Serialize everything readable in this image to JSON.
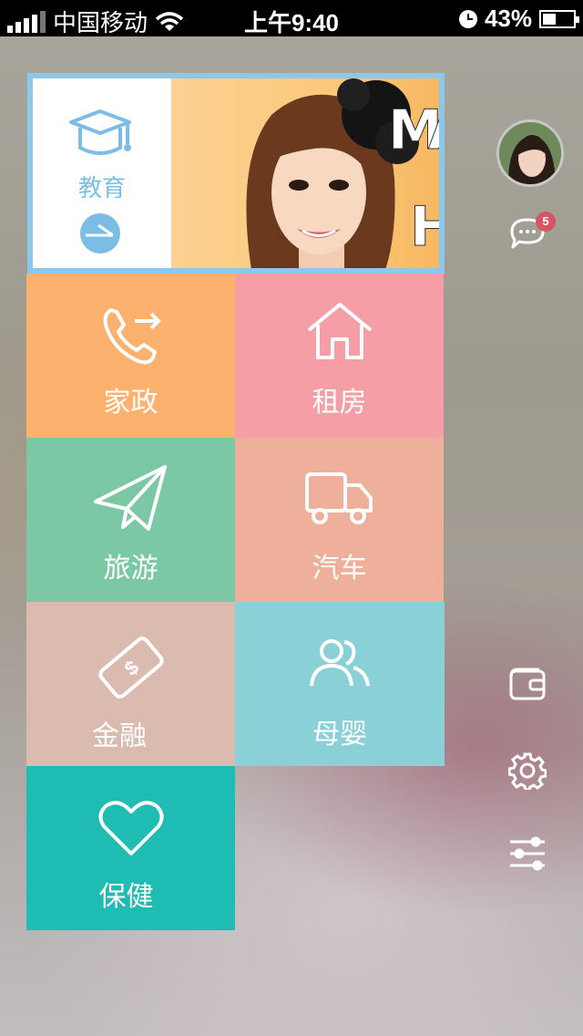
{
  "status_bar": {
    "carrier": "中国移动",
    "time": "上午9:40",
    "battery": "43%",
    "battery_level": 0.43
  },
  "banner": {
    "category_label": "教育",
    "icon": "graduation-cap-icon",
    "photo_text": [
      "M",
      "A",
      "H"
    ]
  },
  "tiles": [
    {
      "label": "家政",
      "icon": "phone-forward-icon",
      "color": "#fdb16f"
    },
    {
      "label": "租房",
      "icon": "house-icon",
      "color": "#f69ea5"
    },
    {
      "label": "旅游",
      "icon": "paper-plane-icon",
      "color": "#7cc8a5"
    },
    {
      "label": "汽车",
      "icon": "truck-icon",
      "color": "#eeb09a"
    },
    {
      "label": "金融",
      "icon": "money-bill-icon",
      "color": "#dbbab0"
    },
    {
      "label": "母婴",
      "icon": "users-icon",
      "color": "#89d1d6"
    },
    {
      "label": "保健",
      "icon": "heart-icon",
      "color": "#1fbcb3"
    }
  ],
  "sidebar": {
    "message_count": "5",
    "icons": [
      "avatar",
      "chat-icon",
      "wallet-icon",
      "gear-icon",
      "sliders-icon"
    ]
  },
  "colors": {
    "banner_border": "#8cc7ec",
    "education_accent": "#7cbde6",
    "badge": "#d85464"
  }
}
